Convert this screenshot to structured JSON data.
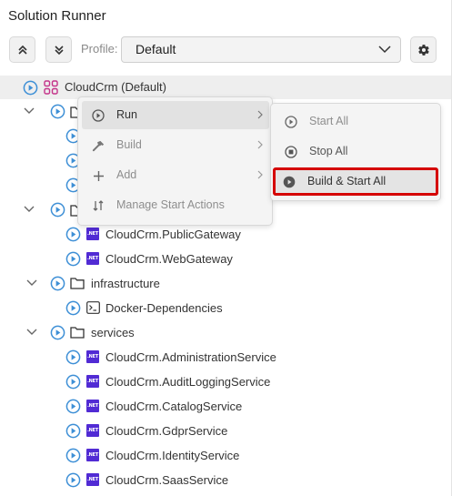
{
  "panel": {
    "title": "Solution Runner"
  },
  "toolbar": {
    "collapse_icon": "chevrons-up-icon",
    "expand_icon": "chevrons-down-icon",
    "profile_label": "Profile:",
    "profile_value": "Default",
    "settings_icon": "gear-icon"
  },
  "tree": {
    "root": {
      "label": "CloudCrm (Default)"
    },
    "gateways": [
      "CloudCrm.PublicGateway",
      "CloudCrm.WebGateway"
    ],
    "infrastructure": {
      "label": "infrastructure",
      "items": [
        "Docker-Dependencies"
      ]
    },
    "services": {
      "label": "services",
      "items": [
        "CloudCrm.AdministrationService",
        "CloudCrm.AuditLoggingService",
        "CloudCrm.CatalogService",
        "CloudCrm.GdprService",
        "CloudCrm.IdentityService",
        "CloudCrm.SaasService"
      ]
    },
    "net_badge": ".NET"
  },
  "context_menu": {
    "items": [
      {
        "label": "Run",
        "icon": "play-circle-icon"
      },
      {
        "label": "Build",
        "icon": "hammer-icon"
      },
      {
        "label": "Add",
        "icon": "plus-icon"
      },
      {
        "label": "Manage Start Actions",
        "icon": "sort-icon"
      }
    ]
  },
  "run_submenu": {
    "items": [
      {
        "label": "Start All",
        "icon": "play-circle-icon"
      },
      {
        "label": "Stop All",
        "icon": "stop-circle-icon"
      },
      {
        "label": "Build & Start All",
        "icon": "play-filled-icon"
      }
    ]
  },
  "colors": {
    "accent_blue": "#3d8fd6",
    "net_purple": "#512bd4",
    "highlight_red": "#d50000",
    "root_icon_pink": "#c4338a"
  }
}
